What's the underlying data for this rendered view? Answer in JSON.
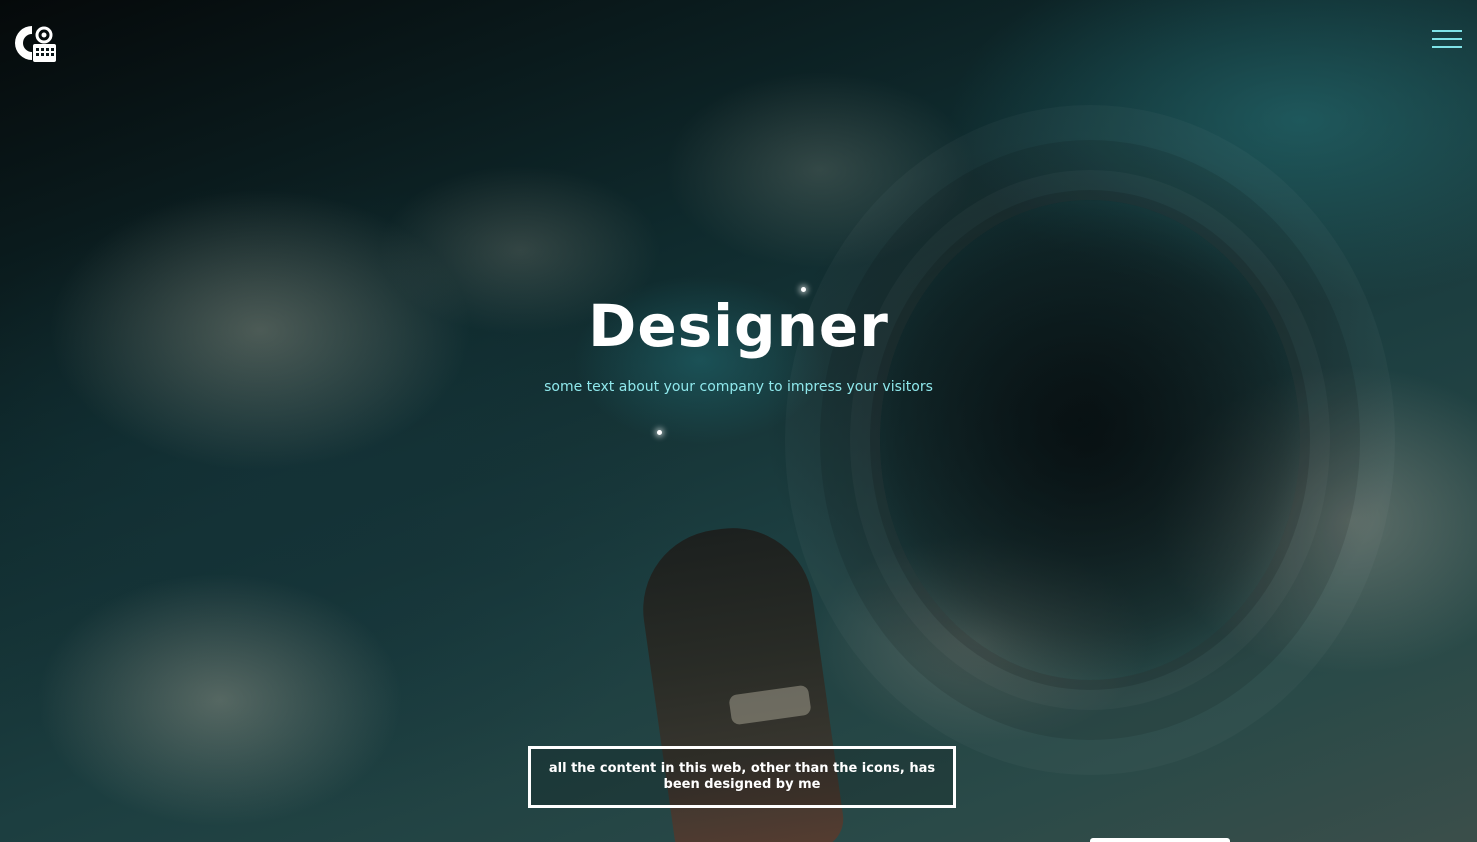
{
  "header": {
    "logo_icon": "camera-calendar-logo-icon",
    "menu_icon": "hamburger-menu-icon",
    "accent_color": "#7fe3e8"
  },
  "hero": {
    "title": "Designer",
    "subtitle": "some text about your company to impress your visitors",
    "notice": "all the content in this web, other than the icons, has been designed by me"
  }
}
